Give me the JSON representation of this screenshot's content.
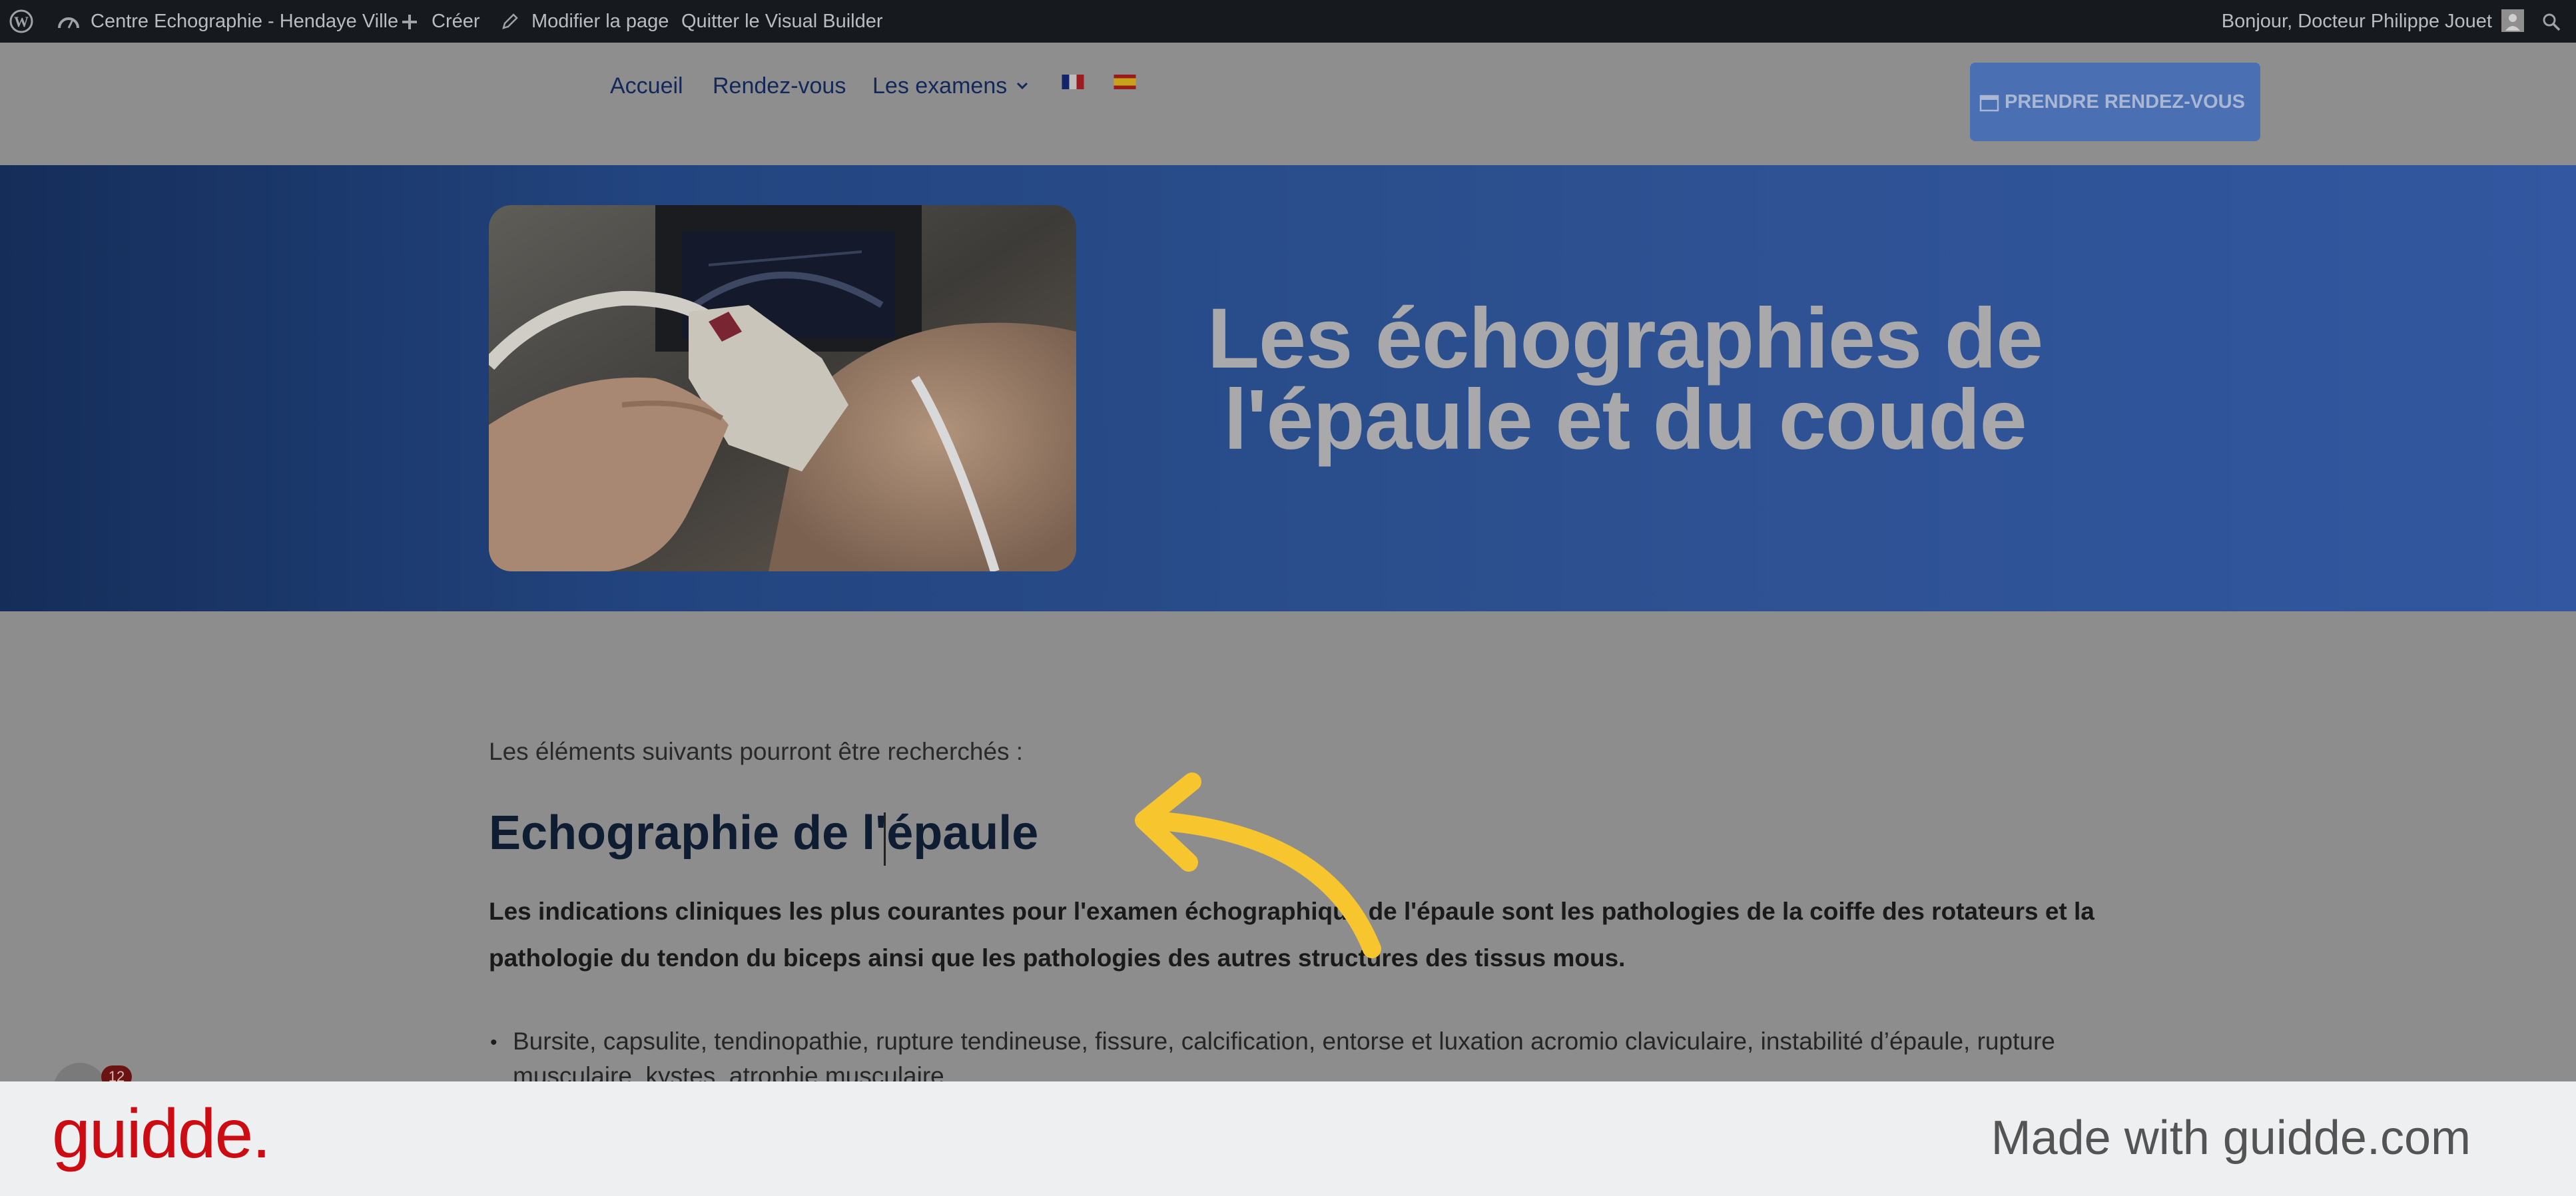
{
  "admin_bar": {
    "site_name": "Centre Echographie - Hendaye Ville",
    "create": "Créer",
    "edit_page": "Modifier la page",
    "quit_builder": "Quitter le Visual Builder",
    "greeting": "Bonjour, Docteur Philippe Jouet"
  },
  "nav": {
    "items": [
      {
        "label": "Accueil"
      },
      {
        "label": "Rendez-vous"
      },
      {
        "label": "Les examens"
      }
    ],
    "cta_label": "PRENDRE RENDEZ-VOUS"
  },
  "hero": {
    "title_line1": "Les échographies de",
    "title_line2": "l'épaule et du coude"
  },
  "content": {
    "intro": "Les éléments suivants pourront être recherchés :",
    "heading": "Echographie de l'épaule",
    "bold_paragraph": "Les indications cliniques les plus courantes pour l'examen échographique de l'épaule sont les pathologies de la coiffe des rotateurs et la pathologie du tendon du biceps ainsi que les pathologies des autres structures des tissus mous.",
    "list_item": "Bursite, capsulite, tendinopathie, rupture tendineuse, fissure, calcification, entorse et luxation acromio claviculaire, instabilité d’épaule, rupture musculaire, kystes, atrophie musculaire"
  },
  "notification_count": "12",
  "footer": {
    "logo": "guidde.",
    "made_with": "Made with guidde.com"
  },
  "colors": {
    "accent_arrow": "#f7c62f",
    "hero_blue": "#2b4f8d",
    "guidde_red": "#cc0b12"
  }
}
